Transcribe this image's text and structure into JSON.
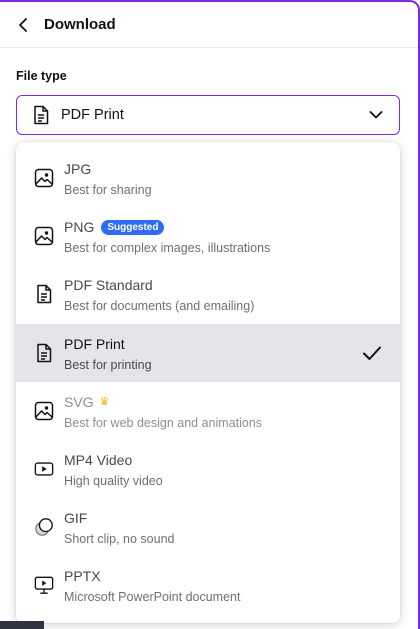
{
  "header": {
    "title": "Download"
  },
  "file_type": {
    "label": "File type",
    "selected_value": "PDF Print",
    "selected_icon": "document-icon"
  },
  "options": [
    {
      "title": "JPG",
      "description": "Best for sharing",
      "icon": "image-icon"
    },
    {
      "title": "PNG",
      "badge": "Suggested",
      "description": "Best for complex images, illustrations",
      "icon": "image-icon"
    },
    {
      "title": "PDF Standard",
      "description": "Best for documents (and emailing)",
      "icon": "document-icon"
    },
    {
      "title": "PDF Print",
      "description": "Best for printing",
      "icon": "document-icon",
      "selected": true
    },
    {
      "title": "SVG",
      "description": "Best for web design and animations",
      "icon": "image-icon",
      "premium": "crown-icon"
    },
    {
      "title": "MP4 Video",
      "description": "High quality video",
      "icon": "video-icon"
    },
    {
      "title": "GIF",
      "description": "Short clip, no sound",
      "icon": "gif-icon"
    },
    {
      "title": "PPTX",
      "description": "Microsoft PowerPoint document",
      "icon": "presentation-icon"
    }
  ],
  "colors": {
    "accent": "#7d2ae8",
    "badge": "#2f6bf6",
    "selected_bg": "#e4e5e8",
    "crown": "#f5b400"
  }
}
